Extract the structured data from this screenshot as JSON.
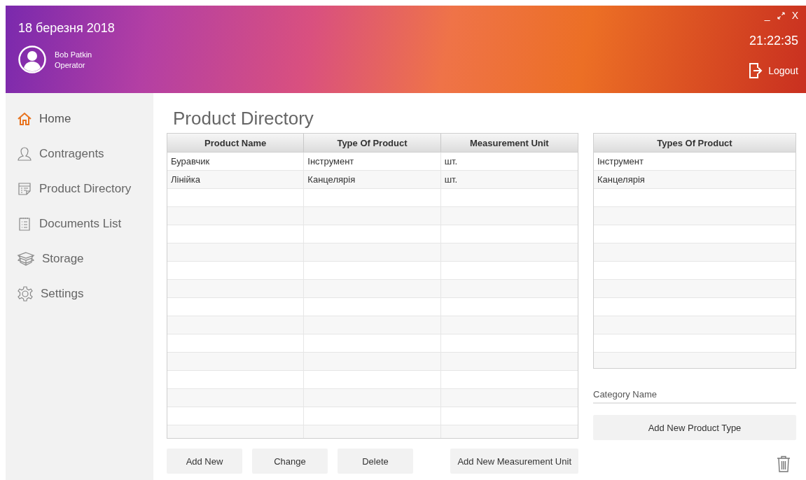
{
  "header": {
    "date": "18 березня 2018",
    "user": {
      "name": "Bob Patkin",
      "role": "Operator"
    },
    "window_controls": {
      "minimize": "_",
      "close": "X"
    },
    "time": "21:22:35",
    "logout": "Logout"
  },
  "sidebar": {
    "items": [
      {
        "label": "Home",
        "kind": "home",
        "selected": true
      },
      {
        "label": "Contragents",
        "kind": "person",
        "selected": false
      },
      {
        "label": "Product Directory",
        "kind": "directory",
        "selected": false
      },
      {
        "label": "Documents List",
        "kind": "list",
        "selected": false
      },
      {
        "label": "Storage",
        "kind": "box",
        "selected": false
      },
      {
        "label": "Settings",
        "kind": "gear",
        "selected": false
      }
    ]
  },
  "page_title": "Product Directory",
  "product_table": {
    "columns": [
      "Product Name",
      "Type Of Product",
      "Measurement Unit"
    ],
    "rows": [
      [
        "Буравчик",
        "Інструмент",
        "шт."
      ],
      [
        "Лінійка",
        "Канцелярія",
        "шт."
      ]
    ]
  },
  "types_table": {
    "columns": [
      "Types Of Product"
    ],
    "rows": [
      [
        "Інструмент"
      ],
      [
        "Канцелярія"
      ]
    ]
  },
  "category_field": {
    "placeholder": "Category Name"
  },
  "add_type_button": "Add New Product Type",
  "buttons": [
    "Add New",
    "Change",
    "Delete",
    "Add New Measurement Unit"
  ]
}
